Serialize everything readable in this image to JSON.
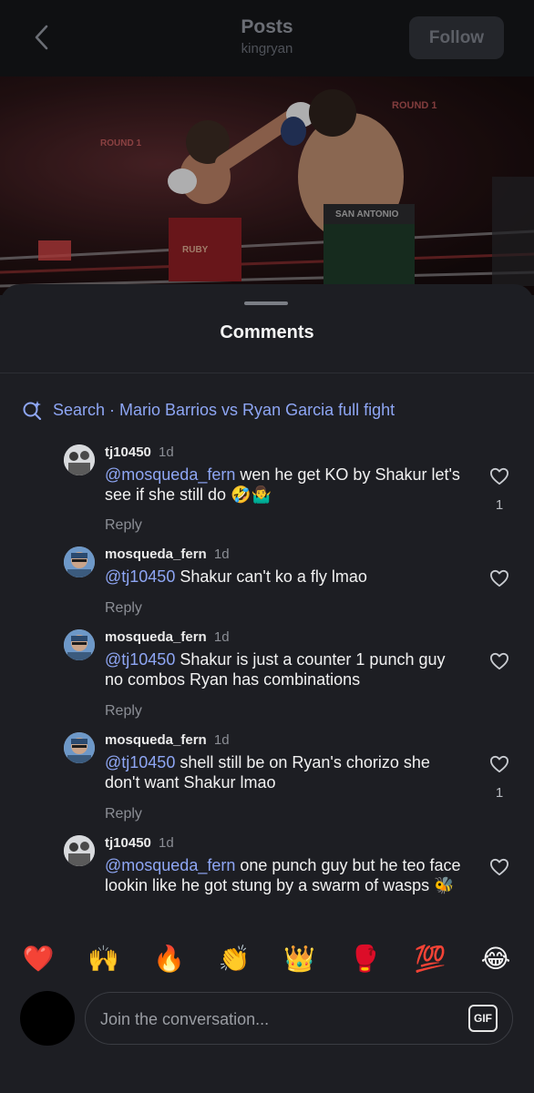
{
  "header": {
    "title": "Posts",
    "subtitle": "kingryan",
    "follow_label": "Follow"
  },
  "video": {
    "overlays": [
      "ROUND 1",
      "ROUND 1",
      "SAN ANTONIO",
      "RUBY"
    ]
  },
  "sheet": {
    "title": "Comments",
    "search_label": "Search · Mario Barrios vs Ryan Garcia full fight"
  },
  "comments": [
    {
      "user": "tj10450",
      "time": "1d",
      "mention": "@mosqueda_fern",
      "text": " wen he get KO by Shakur let's see if she still do 🤣🤷‍♂️",
      "reply": "Reply",
      "likes": "1"
    },
    {
      "user": "mosqueda_fern",
      "time": "1d",
      "mention": "@tj10450",
      "text": " Shakur can't ko a fly lmao",
      "reply": "Reply",
      "likes": ""
    },
    {
      "user": "mosqueda_fern",
      "time": "1d",
      "mention": "@tj10450",
      "text": " Shakur is just a counter 1 punch guy no combos Ryan has combinations",
      "reply": "Reply",
      "likes": ""
    },
    {
      "user": "mosqueda_fern",
      "time": "1d",
      "mention": "@tj10450",
      "text": " shell still be on Ryan's chorizo she don't want Shakur lmao",
      "reply": "Reply",
      "likes": "1"
    },
    {
      "user": "tj10450",
      "time": "1d",
      "mention": "@mosqueda_fern",
      "text": " one punch guy but he teo face lookin like he got stung by a swarm of wasps 🐝",
      "reply": "",
      "likes": ""
    }
  ],
  "emoji_bar": [
    "❤️",
    "🙌",
    "🔥",
    "👏",
    "👑",
    "🥊",
    "💯",
    "😂"
  ],
  "composer": {
    "placeholder": "Join the conversation...",
    "gif_label": "GIF"
  },
  "colors": {
    "background": "#1d1e23",
    "mention": "#8ea6f4",
    "header_bg": "#0f1012"
  }
}
